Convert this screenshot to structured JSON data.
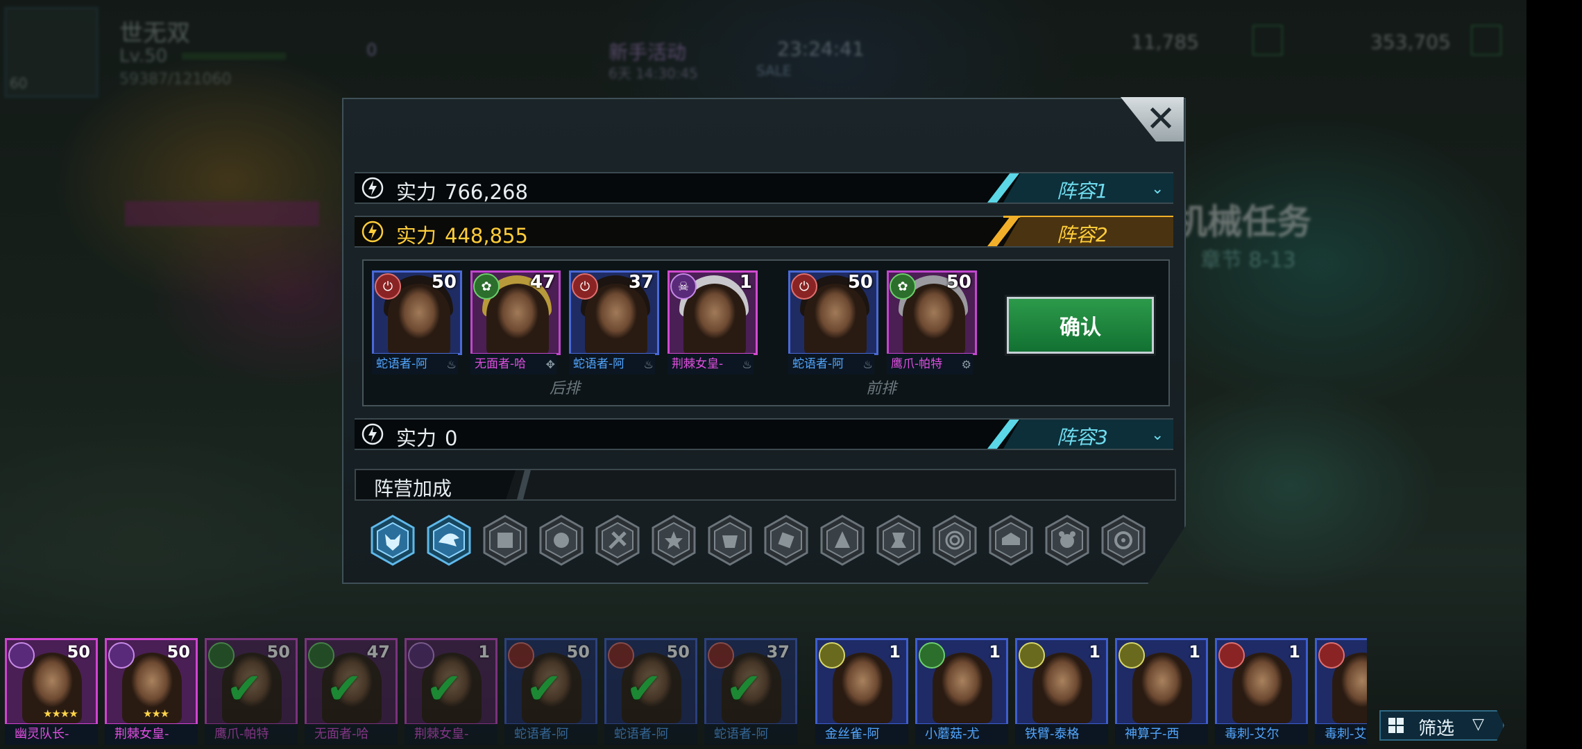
{
  "hud": {
    "player_name": "世无双",
    "level": "Lv.50",
    "exp": "59387/121060",
    "avatar_badge": "60",
    "gem_count": "0",
    "event_title": "新手活动",
    "event_sub": "6天 14:30:45",
    "event_badge": "SALE",
    "timer": "23:24:41",
    "resource_1": "11,785",
    "resource_2": "353,705",
    "bg_sign_title": "机械任务",
    "bg_sign_sub": "章节 8-13"
  },
  "modal": {
    "close_label": "✕",
    "lineups": [
      {
        "power_label": "实力",
        "power_value": "766,268",
        "tag": "阵容1",
        "chevron": "⌄"
      },
      {
        "power_label": "实力",
        "power_value": "448,855",
        "tag": "阵容2"
      },
      {
        "power_label": "实力",
        "power_value": "0",
        "tag": "阵容3",
        "chevron": "⌄"
      }
    ],
    "active_lineup": 2,
    "back_row_label": "后排",
    "front_row_label": "前排",
    "confirm_label": "确认",
    "back_row": [
      {
        "name": "蛇语者-阿",
        "level": "50",
        "faction": "red",
        "faction_glyph": "⏻"
      },
      {
        "name": "无面者-哈",
        "level": "47",
        "faction": "green",
        "faction_glyph": "✿"
      },
      {
        "name": "蛇语者-阿",
        "level": "37",
        "faction": "red",
        "faction_glyph": "⏻"
      },
      {
        "name": "荆棘女皇-",
        "level": "1",
        "faction": "purple",
        "faction_glyph": "☠"
      }
    ],
    "front_row": [
      {
        "name": "蛇语者-阿",
        "level": "50",
        "faction": "red",
        "faction_glyph": "⏻"
      },
      {
        "name": "鹰爪-帕特",
        "level": "50",
        "faction": "green",
        "faction_glyph": "✿"
      }
    ],
    "faction_bonus_label": "阵营加成",
    "faction_badges_active": 2,
    "faction_badges_total": 14
  },
  "roster": [
    {
      "name": "幽灵队长-",
      "level": "50",
      "faction": "purple",
      "stars": "★★★★",
      "used": false
    },
    {
      "name": "荆棘女皇-",
      "level": "50",
      "faction": "purple",
      "stars": "★★★",
      "used": false
    },
    {
      "name": "鹰爪-帕特",
      "level": "50",
      "faction": "green",
      "used": true
    },
    {
      "name": "无面者-哈",
      "level": "47",
      "faction": "green",
      "used": true
    },
    {
      "name": "荆棘女皇-",
      "level": "1",
      "faction": "purple",
      "used": true
    },
    {
      "name": "蛇语者-阿",
      "level": "50",
      "faction": "red",
      "used": true
    },
    {
      "name": "蛇语者-阿",
      "level": "50",
      "faction": "red",
      "used": true
    },
    {
      "name": "蛇语者-阿",
      "level": "37",
      "faction": "red",
      "used": true
    },
    {
      "name": "金丝雀-阿",
      "level": "1",
      "faction": "yellow",
      "used": false
    },
    {
      "name": "小蘑菇-尤",
      "level": "1",
      "faction": "green",
      "used": false
    },
    {
      "name": "铁臂-泰格",
      "level": "1",
      "faction": "yellow",
      "used": false
    },
    {
      "name": "神算子-西",
      "level": "1",
      "faction": "yellow",
      "used": false
    },
    {
      "name": "毒刺-艾尔",
      "level": "1",
      "faction": "red",
      "used": false
    },
    {
      "name": "毒刺-艾",
      "level": "",
      "faction": "red",
      "used": false
    }
  ],
  "filter": {
    "label": "筛选",
    "arrow": "▽"
  },
  "colors": {
    "accent_cyan": "#5bd7e7",
    "accent_gold": "#f2b02a",
    "confirm_green": "#1d8a3e"
  }
}
